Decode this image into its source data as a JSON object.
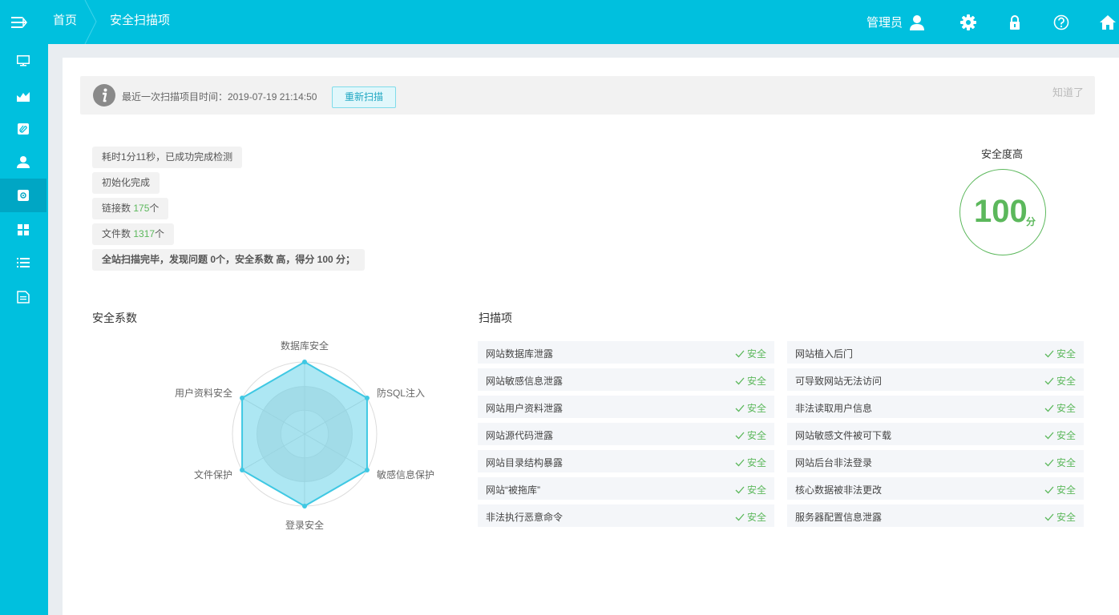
{
  "header": {
    "breadcrumb_home": "首页",
    "breadcrumb_current": "安全扫描项",
    "user_label": "管理员",
    "icons": [
      "user-icon",
      "gear-icon",
      "lock-icon",
      "help-icon",
      "home-icon"
    ]
  },
  "sidebar": {
    "items": [
      {
        "icon": "monitor-icon"
      },
      {
        "icon": "chart-icon"
      },
      {
        "icon": "attachment-icon"
      },
      {
        "icon": "user-icon"
      },
      {
        "icon": "security-scan-icon",
        "active": true
      },
      {
        "icon": "grid-icon"
      },
      {
        "icon": "list-icon"
      },
      {
        "icon": "document-icon"
      }
    ]
  },
  "notice": {
    "message": "最近一次扫描项目时间：2019-07-19 21:14:50",
    "rescan_label": "重新扫描",
    "dismiss_label": "知道了"
  },
  "log": {
    "line1": "耗时1分11秒，已成功完成检测",
    "line2": "初始化完成",
    "links_label": "链接数 ",
    "links_value": "175",
    "links_unit": "个",
    "files_label": "文件数 ",
    "files_value": "1317",
    "files_unit": "个",
    "summary": "全站扫描完毕，发现问题 0个，安全系数 高，得分 100 分；"
  },
  "score": {
    "title": "安全度高",
    "value": "100",
    "unit": "分"
  },
  "radar": {
    "title": "安全系数",
    "axes": [
      "数据库安全",
      "防SQL注入",
      "敏感信息保护",
      "登录安全",
      "文件保护",
      "用户资料安全"
    ],
    "values": [
      100,
      100,
      100,
      100,
      100,
      100
    ],
    "max": 100,
    "fill_color": "#5bd0e8",
    "stroke_color": "#3fc8e3"
  },
  "scan": {
    "title": "扫描项",
    "status_label": "安全",
    "left": [
      "网站数据库泄露",
      "网站敏感信息泄露",
      "网站用户资料泄露",
      "网站源代码泄露",
      "网站目录结构暴露",
      "网站“被拖库”",
      "非法执行恶意命令"
    ],
    "right": [
      "网站植入后门",
      "可导致网站无法访问",
      "非法读取用户信息",
      "网站敏感文件被可下载",
      "网站后台非法登录",
      "核心数据被非法更改",
      "服务器配置信息泄露"
    ]
  }
}
